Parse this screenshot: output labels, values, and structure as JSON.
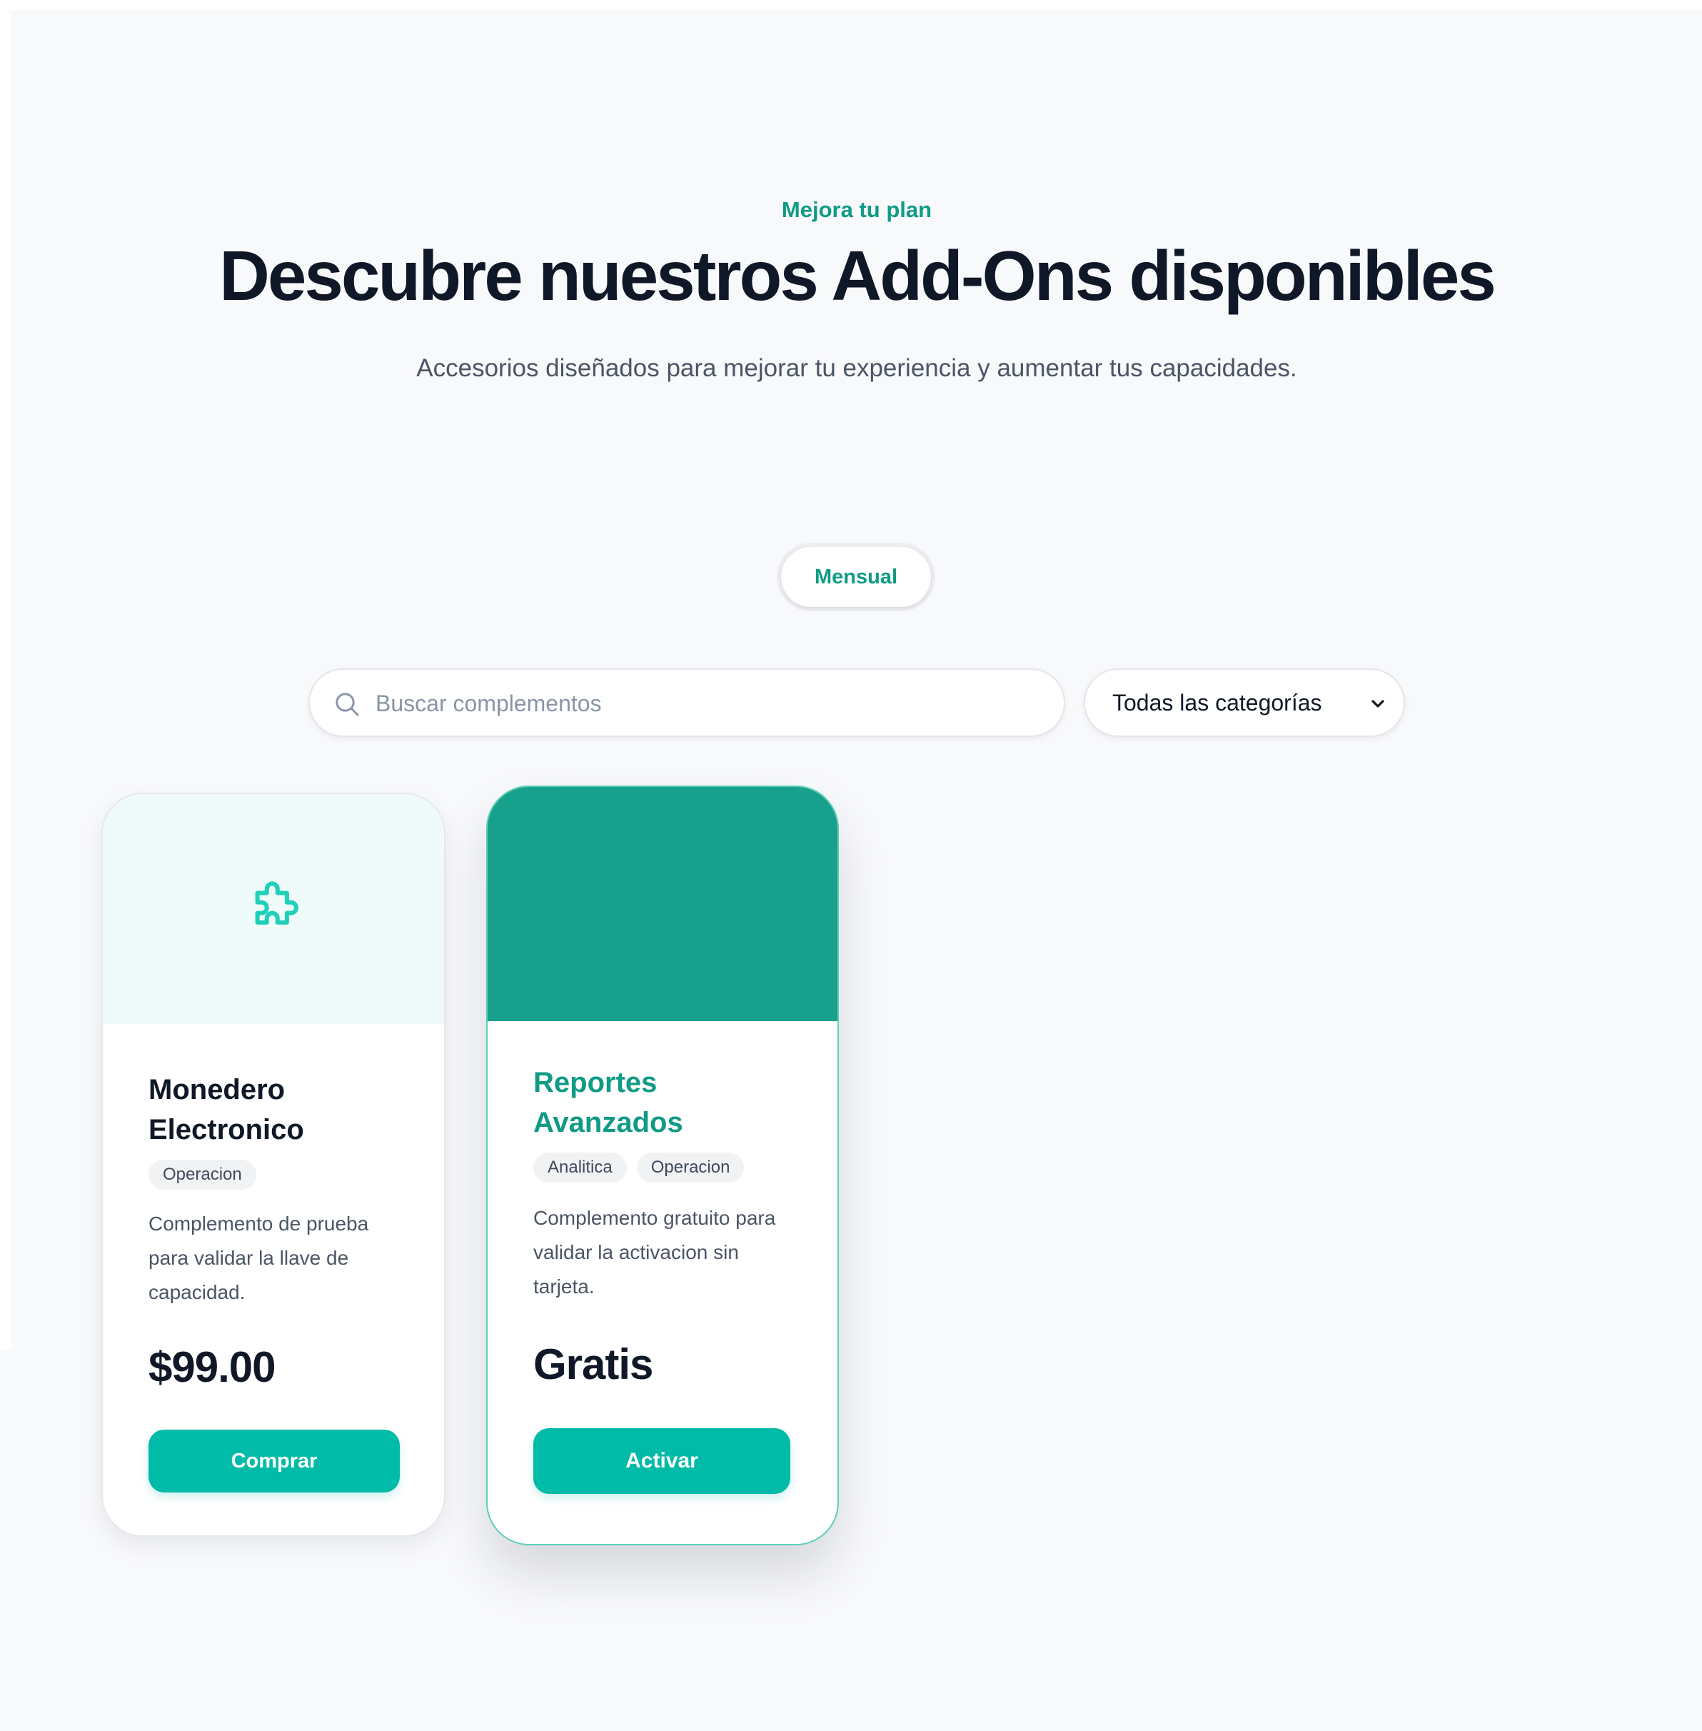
{
  "hero": {
    "eyebrow": "Mejora tu plan",
    "title": "Descubre nuestros Add-Ons disponibles",
    "subtitle": "Accesorios diseñados para mejorar tu experiencia y aumentar tus capacidades."
  },
  "billing_toggle": {
    "selected_label": "Mensual"
  },
  "filters": {
    "search_placeholder": "Buscar complementos",
    "search_value": "",
    "category_selected": "Todas las categorías"
  },
  "addons": [
    {
      "name": "Monedero Electronico",
      "tags": [
        "Operacion"
      ],
      "description": "Complemento de prueba para validar la llave de capacidad.",
      "price": "$99.00",
      "action_label": "Comprar",
      "icon": "puzzle-icon"
    },
    {
      "name": "Reportes Avanzados",
      "tags": [
        "Analitica",
        "Operacion"
      ],
      "description": "Complemento gratuito para validar la activacion sin tarjeta.",
      "price": "Gratis",
      "action_label": "Activar",
      "icon": ""
    }
  ],
  "colors": {
    "accent": "#0f9b85",
    "button": "#00bba7",
    "header_dark_teal": "#17a08c",
    "header_light": "#eefbf8",
    "heading": "#101828"
  }
}
